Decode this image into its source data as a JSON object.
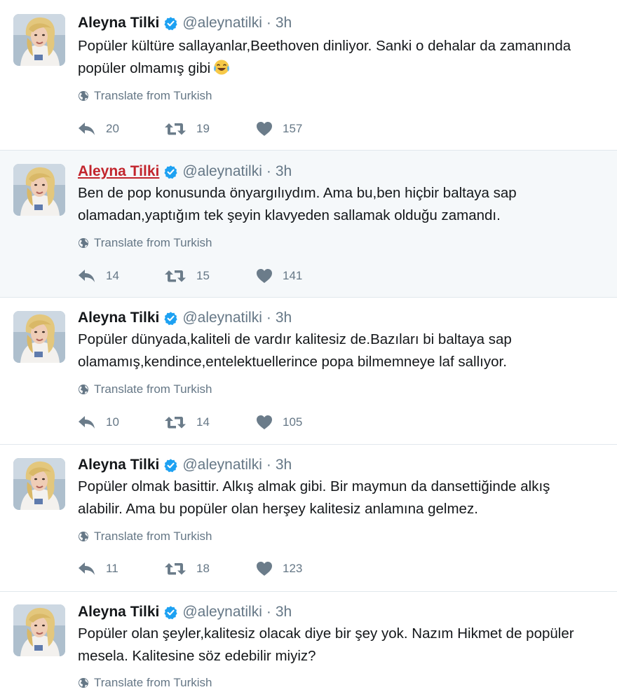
{
  "colors": {
    "name": "#14171a",
    "name_highlighted": "#c2252d",
    "meta": "#657786",
    "verified": "#1da1f2",
    "highlight_bg": "#f5f8fa",
    "divider": "#e1e8ed"
  },
  "icons": {
    "verified": "verified-badge-icon",
    "translate": "globe-icon",
    "reply": "reply-icon",
    "retweet": "retweet-icon",
    "like": "heart-icon",
    "emoji": "tears-of-joy-emoji"
  },
  "tweets": [
    {
      "name": "Aleyna Tilki",
      "handle": "@aleynatilki",
      "separator": "·",
      "time": "3h",
      "lines": [
        "Popüler kültüre sallayanlar,Beethoven dinliyor. Sanki o dehalar da zamanında",
        "popüler olmamış gibi"
      ],
      "translate": "Translate from Turkish",
      "replies": "20",
      "retweets": "19",
      "likes": "157"
    },
    {
      "name": "Aleyna Tilki",
      "handle": "@aleynatilki",
      "separator": "·",
      "time": "3h",
      "lines": [
        "Ben de pop konusunda önyargılıydım. Ama bu,ben hiçbir baltaya sap",
        "olamadan,yaptığım tek şeyin klavyeden sallamak olduğu zamandı."
      ],
      "translate": "Translate from Turkish",
      "replies": "14",
      "retweets": "15",
      "likes": "141"
    },
    {
      "name": "Aleyna Tilki",
      "handle": "@aleynatilki",
      "separator": "·",
      "time": "3h",
      "lines": [
        "Popüler dünyada,kaliteli de vardır kalitesiz de.Bazıları bi baltaya sap",
        "olamamış,kendince,entelektuellerince popa bilmemneye laf sallıyor."
      ],
      "translate": "Translate from Turkish",
      "replies": "10",
      "retweets": "14",
      "likes": "105"
    },
    {
      "name": "Aleyna Tilki",
      "handle": "@aleynatilki",
      "separator": "·",
      "time": "3h",
      "lines": [
        "Popüler olmak basittir. Alkış almak gibi. Bir maymun da dansettiğinde alkış",
        "alabilir. Ama bu popüler olan herşey kalitesiz anlamına gelmez."
      ],
      "translate": "Translate from Turkish",
      "replies": "11",
      "retweets": "18",
      "likes": "123"
    },
    {
      "name": "Aleyna Tilki",
      "handle": "@aleynatilki",
      "separator": "·",
      "time": "3h",
      "lines": [
        "Popüler olan şeyler,kalitesiz olacak diye bir şey yok. Nazım Hikmet de popüler",
        "mesela. Kalitesine söz edebilir miyiz?"
      ],
      "translate": "Translate from Turkish"
    }
  ]
}
